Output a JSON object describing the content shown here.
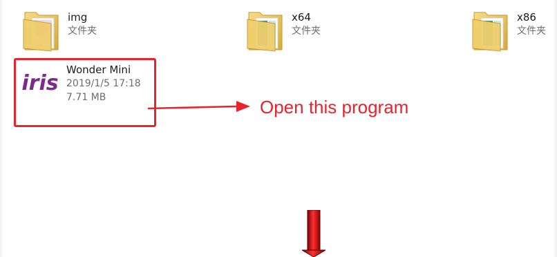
{
  "items": [
    {
      "name": "img",
      "type": "文件夹"
    },
    {
      "name": "x64",
      "type": "文件夹"
    },
    {
      "name": "x86",
      "type": "文件夹"
    }
  ],
  "app": {
    "name": "Wonder Mini",
    "date": "2019/1/5 17:18",
    "size": "7.71 MB",
    "logo_text": "iris",
    "logo_color": "#7b2a8c"
  },
  "annotation": {
    "text": "Open this program",
    "color": "#e8232a"
  },
  "colors": {
    "folder": "#e9c55a",
    "highlight": "#e8232a"
  }
}
